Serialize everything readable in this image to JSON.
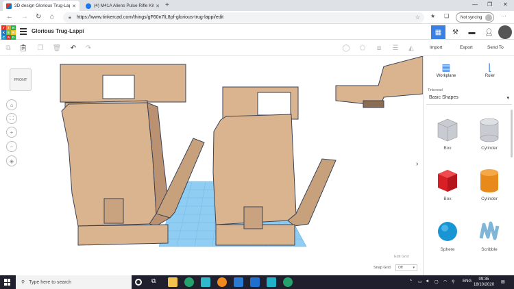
{
  "browser": {
    "tabs": [
      {
        "label": "3D design Glorious Trug-Lappi |",
        "active": true
      },
      {
        "label": "(4) M41A Aliens Pulse Rifle Kit |",
        "active": false
      }
    ],
    "new_tab": "+",
    "window_controls": [
      "—",
      "❐",
      "✕"
    ],
    "url": "https://www.tinkercad.com/things/gF60n7lL8pf-glorious-trug-lappi/edit",
    "sync_label": "Not syncing",
    "menu": "···"
  },
  "app": {
    "logo_letters": [
      "T",
      "I",
      "N",
      "K",
      "E",
      "R",
      "C",
      "A",
      "D"
    ],
    "logo_colors": [
      "#e2332b",
      "#f68d2e",
      "#27b24a",
      "#1877be",
      "#6cc04a",
      "#f6c31b",
      "#1e90c8",
      "#e2332b",
      "#27b24a"
    ],
    "design_title": "Glorious Trug-Lappi",
    "accent": "#3b7fe0"
  },
  "toolbar": {
    "import": "Import",
    "export": "Export",
    "send_to": "Send To"
  },
  "canvas": {
    "viewcube_label": "FRONT",
    "edit_grid": "Edit Grid",
    "snap_grid_label": "Snap Grid",
    "snap_grid_value": "Off",
    "shape_color": "#d9b48f",
    "grid_color": "#5fb1e8"
  },
  "panel": {
    "workplane": "Workplane",
    "ruler": "Ruler",
    "library_caption": "Tinkercad",
    "library": "Basic Shapes",
    "shapes": [
      {
        "label": "Box",
        "icon": "box-hole-icon"
      },
      {
        "label": "Cylinder",
        "icon": "cylinder-hole-icon"
      },
      {
        "label": "Box",
        "icon": "box-icon"
      },
      {
        "label": "Cylinder",
        "icon": "cylinder-icon"
      },
      {
        "label": "Sphere",
        "icon": "sphere-icon"
      },
      {
        "label": "Scribble",
        "icon": "scribble-icon"
      }
    ]
  },
  "taskbar": {
    "search_placeholder": "Type here to search",
    "language": "ENG",
    "time": "09:35",
    "date": "18/10/2020"
  }
}
